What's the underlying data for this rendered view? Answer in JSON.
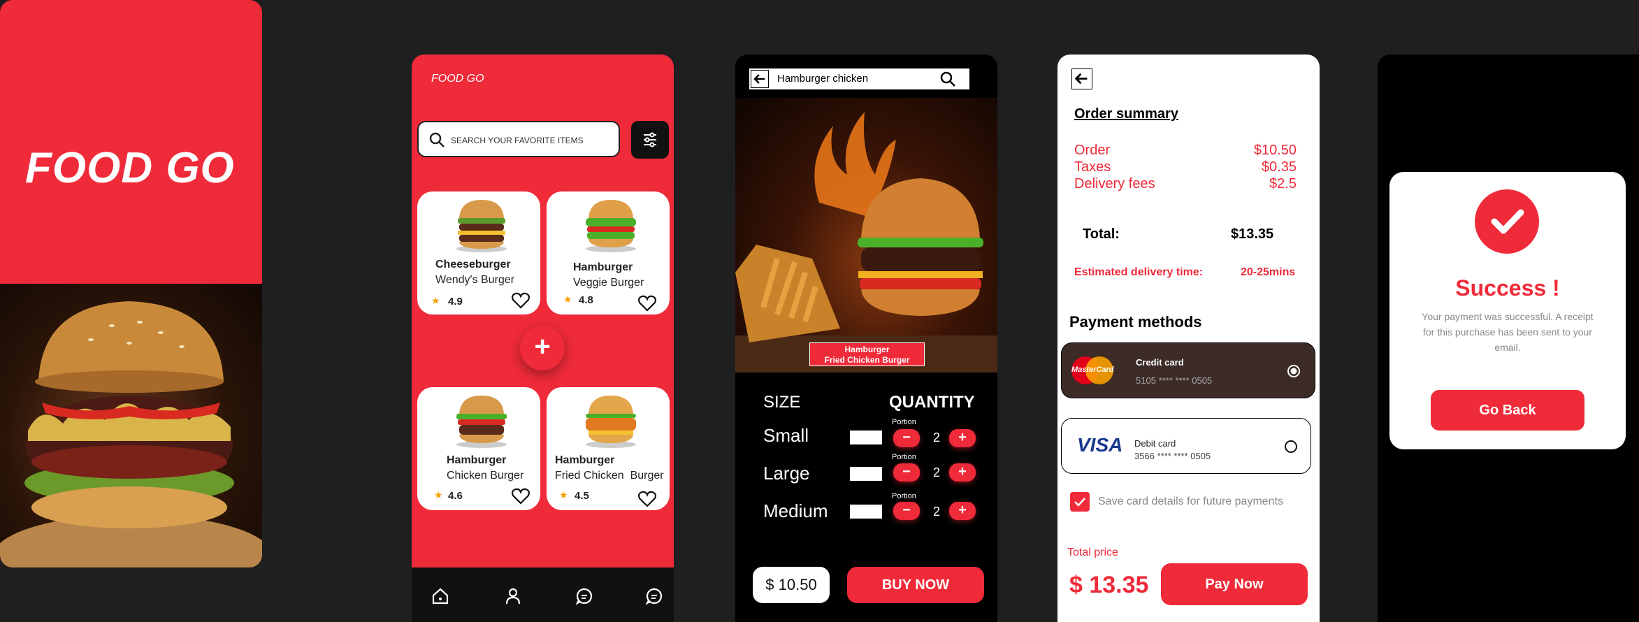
{
  "splash": {
    "title": "FOOD GO"
  },
  "home": {
    "brand": "FOOD GO",
    "search_placeholder": "SEARCH YOUR FAVORITE ITEMS",
    "items": [
      {
        "name": "Cheeseburger",
        "sub": "Wendy's Burger",
        "rating": "4.9"
      },
      {
        "name": "Hamburger",
        "sub": "Veggie Burger",
        "rating": "4.8"
      },
      {
        "name": "Hamburger",
        "sub": "Chicken Burger",
        "rating": "4.6"
      },
      {
        "name": "Hamburger",
        "sub": "Fried Chicken  Burger",
        "rating": "4.5"
      }
    ],
    "add_label": "+"
  },
  "detail": {
    "search_value": "Hamburger chicken",
    "caption_line1": "Hamburger",
    "caption_line2": "Fried Chicken Burger",
    "size_header": "SIZE",
    "quantity_header": "QUANTITY",
    "portion_label": "Portion",
    "sizes": [
      {
        "label": "Small",
        "qty": "2"
      },
      {
        "label": "Large",
        "qty": "2"
      },
      {
        "label": "Medium",
        "qty": "2"
      }
    ],
    "price": "$ 10.50",
    "buy_label": "BUY NOW"
  },
  "order": {
    "title": "Order summary",
    "rows": [
      {
        "label": "Order",
        "value": "$10.50"
      },
      {
        "label": "Taxes",
        "value": "$0.35"
      },
      {
        "label": "Delivery fees",
        "value": "$2.5"
      }
    ],
    "total_label": "Total:",
    "total_value": "$13.35",
    "est_label": "Estimated delivery time:",
    "est_value": "20-25mins",
    "payment_title": "Payment methods",
    "credit": {
      "brand": "MasterCard",
      "label": "Credit card",
      "number": "5105 **** **** 0505"
    },
    "debit": {
      "brand": "VISA",
      "label": "Debit card",
      "number": "3566 **** **** 0505"
    },
    "save_label": "Save card details for future payments",
    "total_price_label": "Total price",
    "total_price_value": "$ 13.35",
    "pay_label": "Pay Now"
  },
  "success": {
    "title": "Success !",
    "message": "Your payment was successful. A receipt for this purchase has been sent to your email.",
    "button": "Go Back"
  },
  "colors": {
    "accent": "#ef2a39",
    "dark": "#1f1f1f"
  }
}
